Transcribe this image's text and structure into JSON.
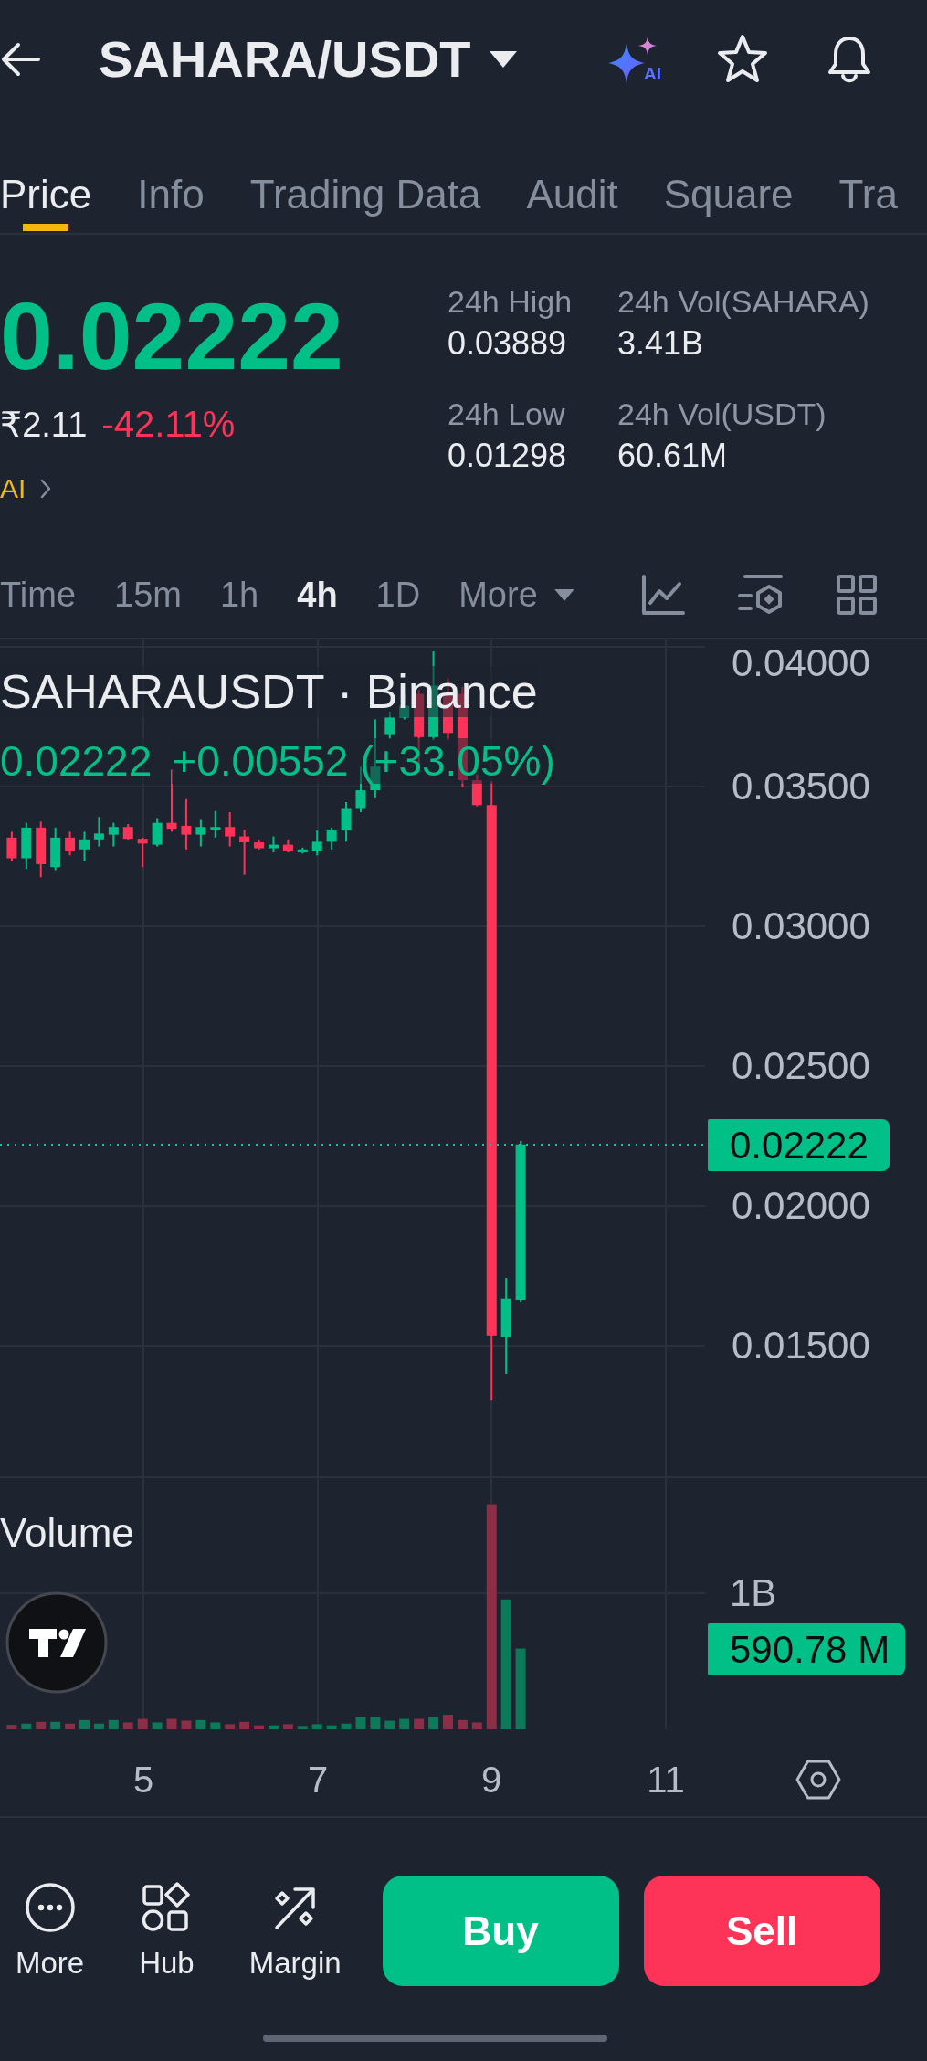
{
  "header": {
    "title": "SAHARA/USDT",
    "ai_badge": "AI"
  },
  "tabs": [
    {
      "label": "Price",
      "selected": true
    },
    {
      "label": "Info",
      "selected": false
    },
    {
      "label": "Trading Data",
      "selected": false
    },
    {
      "label": "Audit",
      "selected": false
    },
    {
      "label": "Square",
      "selected": false
    },
    {
      "label": "Tra",
      "selected": false
    }
  ],
  "ticker": {
    "last_price": "0.02222",
    "fiat_price": "₹2.11",
    "change": "-42.11%",
    "link": "AI",
    "stats": [
      {
        "label": "24h High",
        "value": "0.03889"
      },
      {
        "label": "24h Vol(SAHARA)",
        "value": "3.41B"
      },
      {
        "label": "24h Low",
        "value": "0.01298"
      },
      {
        "label": "24h Vol(USDT)",
        "value": "60.61M"
      }
    ]
  },
  "intervals": [
    {
      "label": "Time",
      "kind": "interval",
      "selected": false
    },
    {
      "label": "15m",
      "kind": "interval",
      "selected": false
    },
    {
      "label": "1h",
      "kind": "interval",
      "selected": false
    },
    {
      "label": "4h",
      "kind": "interval",
      "selected": true
    },
    {
      "label": "1D",
      "kind": "interval",
      "selected": false
    },
    {
      "label": "More",
      "kind": "menu",
      "selected": false
    }
  ],
  "chart": {
    "symbol": "SAHARAUSDT · Binance",
    "last_price": "0.02222",
    "change": "+0.00552 (+33.05%)",
    "price_axis": [
      "0.04000",
      "0.03500",
      "0.03000",
      "0.02500",
      "0.02000",
      "0.01500"
    ],
    "price_tag": "0.02222",
    "volume_title": "Volume",
    "volume_axis": [
      "1B"
    ],
    "volume_tag": "590.78 M",
    "time_axis": [
      "5",
      "7",
      "9",
      "11"
    ]
  },
  "bottom_bar": {
    "actions": [
      {
        "label": "More",
        "kind": "more"
      },
      {
        "label": "Hub",
        "kind": "hub"
      },
      {
        "label": "Margin",
        "kind": "margin"
      }
    ],
    "buy": "Buy",
    "sell": "Sell"
  }
}
